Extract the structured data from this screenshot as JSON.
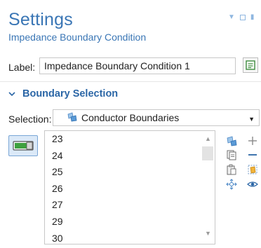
{
  "header": {
    "title": "Settings",
    "subtitle": "Impedance Boundary Condition"
  },
  "label_field": {
    "caption": "Label:",
    "value": "Impedance Boundary Condition 1"
  },
  "section": {
    "title": "Boundary Selection",
    "expanded": true
  },
  "selection": {
    "caption": "Selection:",
    "value": "Conductor Boundaries"
  },
  "boundary_list": {
    "items": [
      "23",
      "24",
      "25",
      "26",
      "27",
      "29",
      "30"
    ]
  },
  "toolbar_icons": [
    "paint-selection-icon",
    "add-icon",
    "copy-icon",
    "remove-icon",
    "paste-icon",
    "clear-selection-icon",
    "zoom-to-selection-icon",
    "show-selection-icon"
  ],
  "colors": {
    "accent": "#3a76b5",
    "header_blue": "#2b66a6"
  }
}
